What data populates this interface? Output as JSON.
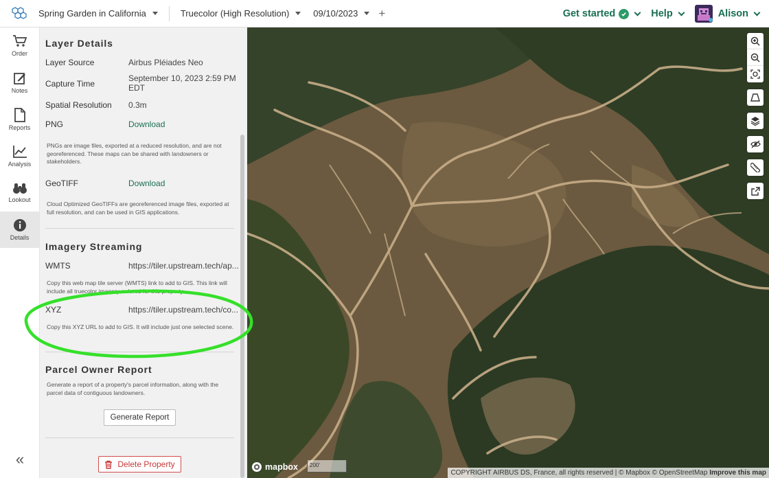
{
  "topbar": {
    "property": "Spring Garden in California",
    "layer": "Truecolor (High Resolution)",
    "date": "09/10/2023",
    "add": "+",
    "get_started": "Get started",
    "help": "Help",
    "user": "Alison"
  },
  "rail": {
    "items": [
      {
        "label": "Order",
        "icon": "cart-icon"
      },
      {
        "label": "Notes",
        "icon": "notes-icon"
      },
      {
        "label": "Reports",
        "icon": "document-icon"
      },
      {
        "label": "Analysis",
        "icon": "chart-icon"
      },
      {
        "label": "Lookout",
        "icon": "binoculars-icon"
      },
      {
        "label": "Details",
        "icon": "info-icon"
      }
    ],
    "active": "Details",
    "collapse": "«"
  },
  "details": {
    "title": "Layer Details",
    "source_label": "Layer Source",
    "source_value": "Airbus Pléiades Neo",
    "capture_label": "Capture Time",
    "capture_value": "September 10, 2023 2:59 PM EDT",
    "resolution_label": "Spatial Resolution",
    "resolution_value": "0.3m",
    "png_label": "PNG",
    "png_link": "Download",
    "png_note": "PNGs are image files, exported at a reduced resolution, and are not georeferenced. These maps can be shared with landowners or stakeholders.",
    "geotiff_label": "GeoTIFF",
    "geotiff_link": "Download",
    "geotiff_note": "Cloud Optimized GeoTIFFs are georeferenced image files, exported at full resolution, and can be used in GIS applications."
  },
  "streaming": {
    "title": "Imagery Streaming",
    "wmts_label": "WMTS",
    "wmts_value": "https://tiler.upstream.tech/ap...",
    "wmts_note": "Copy this web map tile server (WMTS) link to add to GIS. This link will include all truecolor imagery ordered for this property.",
    "xyz_label": "XYZ",
    "xyz_value": "https://tiler.upstream.tech/co...",
    "xyz_note": "Copy this XYZ URL to add to GIS. It will include just one selected scene."
  },
  "parcel": {
    "title": "Parcel Owner Report",
    "note": "Generate a report of a property's parcel information, along with the parcel data of contiguous landowners.",
    "button": "Generate Report"
  },
  "delete_button": "Delete Property",
  "map": {
    "mapbox": "mapbox",
    "scale": "200'",
    "attribution": "COPYRIGHT AIRBUS DS, France, all rights reserved | © Mapbox © OpenStreetMap",
    "improve": "Improve this map",
    "controls": [
      "zoom-in-icon",
      "zoom-out-icon",
      "fit-bounds-icon",
      "perspective-icon",
      "layers-icon",
      "hide-icon",
      "ruler-icon",
      "external-link-icon"
    ]
  },
  "colors": {
    "brand": "#1a6e53",
    "danger": "#c93838",
    "annotation": "#35e02a"
  }
}
